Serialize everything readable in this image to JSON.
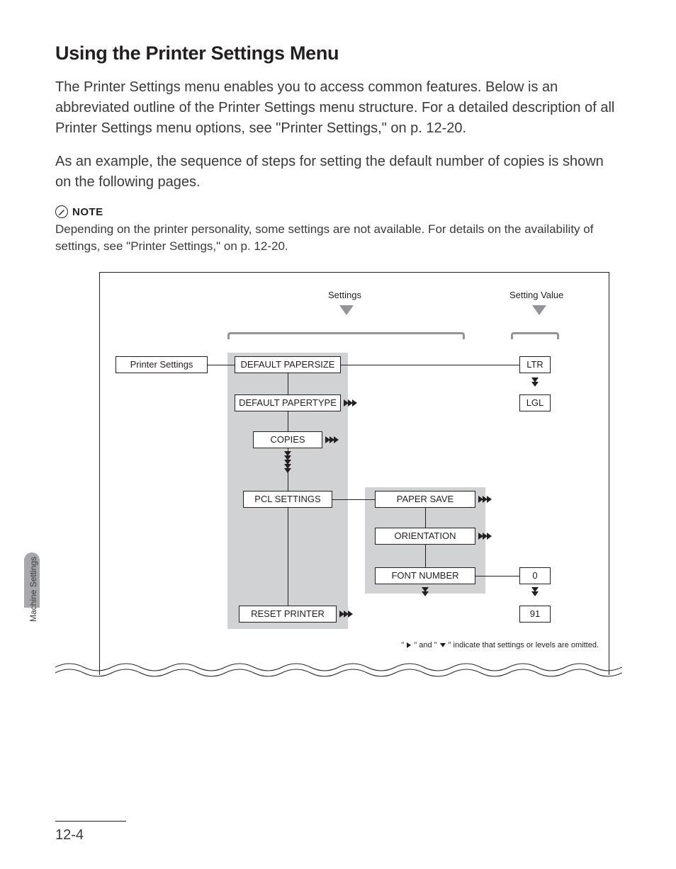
{
  "heading": "Using the Printer Settings Menu",
  "para1": "The Printer Settings menu enables you to access common features. Below is an abbreviated outline of the Printer Settings menu structure. For a detailed description of all Printer Settings menu options, see \"Printer Settings,\" on p. 12-20.",
  "para2": "As an example, the sequence of steps for setting the default number of copies is shown on the following pages.",
  "note_label": "NOTE",
  "note_text": "Depending on the printer personality, some settings are not available. For details on the availability of settings, see \"Printer Settings,\" on p. 12-20.",
  "diagram": {
    "col_settings": "Settings",
    "col_value": "Setting Value",
    "root": "Printer Settings",
    "items": {
      "default_papersize": "DEFAULT PAPERSIZE",
      "default_papertype": "DEFAULT PAPERTYPE",
      "copies": "COPIES",
      "pcl_settings": "PCL SETTINGS",
      "reset_printer": "RESET PRINTER",
      "paper_save": "PAPER SAVE",
      "orientation": "ORIENTATION",
      "font_number": "FONT NUMBER"
    },
    "values": {
      "ltr": "LTR",
      "lgl": "LGL",
      "v0": "0",
      "v91": "91"
    },
    "footnote_pre": "\" ",
    "footnote_mid": " \" and \" ",
    "footnote_post": " \" indicate that settings or levels are omitted."
  },
  "side_label": "Machine Settings",
  "page_number": "12-4"
}
